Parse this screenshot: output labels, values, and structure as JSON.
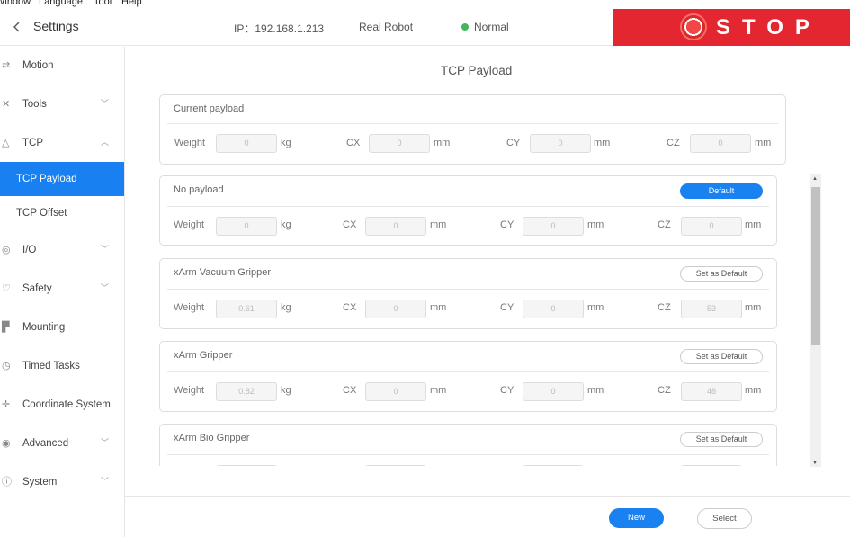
{
  "menubar": {
    "items": [
      "Window",
      "Language",
      "Tool",
      "Help"
    ]
  },
  "header": {
    "title": "Settings",
    "ip": "IP：192.168.1.213",
    "robot": "Real Robot",
    "status": "Normal",
    "status_color": "#41b65a",
    "stop_label": "STOP",
    "stop_color": "#e3262f"
  },
  "sidebar": {
    "items": [
      {
        "label": "Motion",
        "icon": "motion-icon"
      },
      {
        "label": "Tools",
        "icon": "tools-icon"
      },
      {
        "label": "TCP",
        "icon": "tcp-icon"
      },
      {
        "label": "TCP Payload"
      },
      {
        "label": "TCP Offset"
      },
      {
        "label": "I/O",
        "icon": "io-icon"
      },
      {
        "label": "Safety",
        "icon": "safety-icon"
      },
      {
        "label": "Mounting",
        "icon": "mounting-icon"
      },
      {
        "label": "Timed Tasks",
        "icon": "clock-icon"
      },
      {
        "label": "Coordinate System",
        "icon": "coordinate-icon"
      },
      {
        "label": "Advanced",
        "icon": "advanced-icon"
      },
      {
        "label": "System",
        "icon": "info-icon"
      }
    ],
    "active_color": "#1880f0"
  },
  "main": {
    "title": "TCP Payload",
    "units": {
      "weight": "kg",
      "length": "mm"
    },
    "fields": {
      "weight": "Weight",
      "cx": "CX",
      "cy": "CY",
      "cz": "CZ"
    },
    "current": {
      "title": "Current payload",
      "weight": "0",
      "cx": "0",
      "cy": "0",
      "cz": "0"
    },
    "payloads": [
      {
        "title": "No payload",
        "button": "Default",
        "weight": "0",
        "cx": "0",
        "cy": "0",
        "cz": "0"
      },
      {
        "title": "xArm Vacuum Gripper",
        "button": "Set as Default",
        "weight": "0.61",
        "cx": "0",
        "cy": "0",
        "cz": "53"
      },
      {
        "title": "xArm Gripper",
        "button": "Set as Default",
        "weight": "0.82",
        "cx": "0",
        "cy": "0",
        "cz": "48"
      },
      {
        "title": "xArm Bio Gripper",
        "button": "Set as Default",
        "weight": "",
        "cx": "",
        "cy": "",
        "cz": ""
      }
    ]
  },
  "footer": {
    "new_label": "New",
    "select_label": "Select"
  }
}
